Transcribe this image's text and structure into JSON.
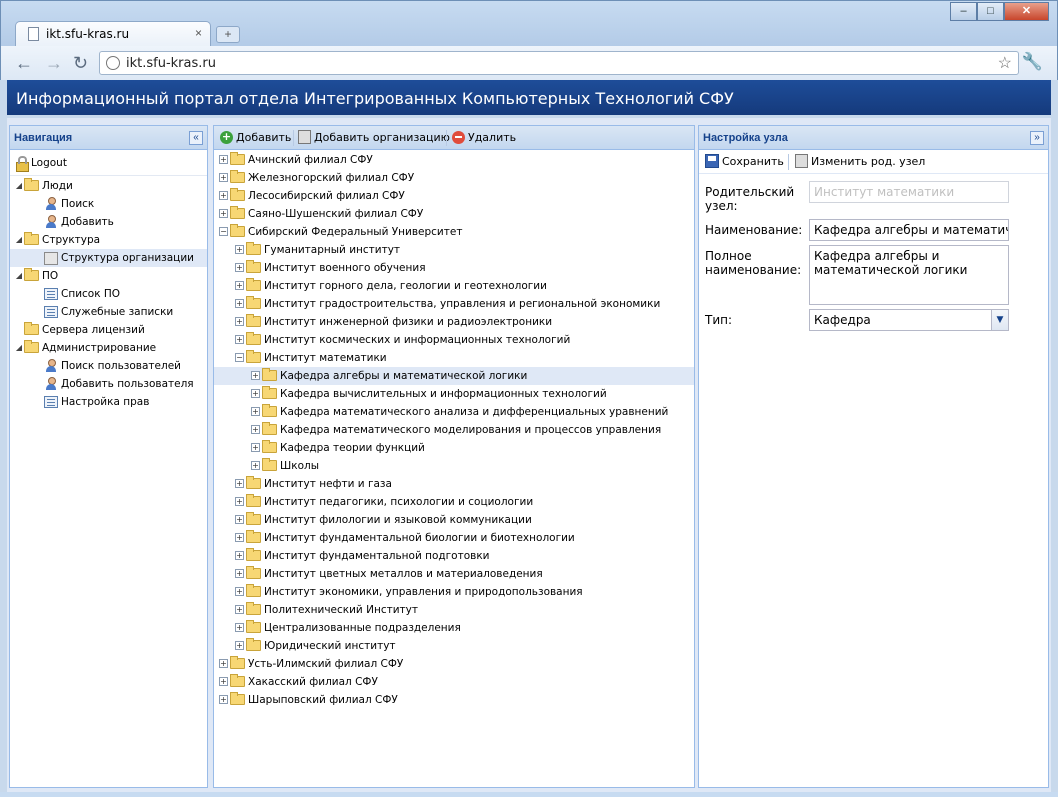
{
  "browser": {
    "tab_title": "ikt.sfu-kras.ru",
    "tab_close": "×",
    "new_tab": "+",
    "url": "ikt.sfu-kras.ru",
    "back": "←",
    "forward": "→",
    "reload": "↻",
    "star": "☆",
    "wrench": "🔧",
    "minimize": "–",
    "maximize": "□",
    "close": "✕"
  },
  "app": {
    "title": "Информационный портал отдела Интегрированных Компьютерных Технологий СФУ"
  },
  "nav": {
    "title": "Навигация",
    "collapse": "«",
    "logout": "Logout",
    "items": [
      {
        "label": "Люди",
        "level": 0,
        "icon": "folder"
      },
      {
        "label": "Поиск",
        "level": 1,
        "icon": "person"
      },
      {
        "label": "Добавить",
        "level": 1,
        "icon": "person"
      },
      {
        "label": "Структура",
        "level": 0,
        "icon": "folder"
      },
      {
        "label": "Структура организации",
        "level": 1,
        "icon": "org",
        "selected": true
      },
      {
        "label": "ПО",
        "level": 0,
        "icon": "folder"
      },
      {
        "label": "Список ПО",
        "level": 1,
        "icon": "list"
      },
      {
        "label": "Служебные записки",
        "level": 1,
        "icon": "list"
      },
      {
        "label": "Сервера лицензий",
        "level": 0,
        "icon": "folder"
      },
      {
        "label": "Администрирование",
        "level": 0,
        "icon": "folder"
      },
      {
        "label": "Поиск пользователей",
        "level": 1,
        "icon": "person"
      },
      {
        "label": "Добавить пользователя",
        "level": 1,
        "icon": "person"
      },
      {
        "label": "Настройка прав",
        "level": 1,
        "icon": "list"
      }
    ]
  },
  "tree_toolbar": {
    "add": "Добавить",
    "add_org": "Добавить организацию",
    "delete": "Удалить"
  },
  "tree": [
    {
      "label": "Ачинский филиал СФУ",
      "level": 0,
      "expanded": false
    },
    {
      "label": "Железногорский филиал СФУ",
      "level": 0,
      "expanded": false
    },
    {
      "label": "Лесосибирский филиал СФУ",
      "level": 0,
      "expanded": false
    },
    {
      "label": "Саяно-Шушенский филиал СФУ",
      "level": 0,
      "expanded": false
    },
    {
      "label": "Сибирский Федеральный Университет",
      "level": 0,
      "expanded": true
    },
    {
      "label": "Гуманитарный институт",
      "level": 1,
      "expanded": false
    },
    {
      "label": "Институт военного обучения",
      "level": 1,
      "expanded": false
    },
    {
      "label": "Институт горного дела, геологии и геотехнологии",
      "level": 1,
      "expanded": false
    },
    {
      "label": "Институт градостроительства, управления и региональной экономики",
      "level": 1,
      "expanded": false
    },
    {
      "label": "Институт инженерной физики и радиоэлектроники",
      "level": 1,
      "expanded": false
    },
    {
      "label": "Институт космических и информационных технологий",
      "level": 1,
      "expanded": false
    },
    {
      "label": "Институт математики",
      "level": 1,
      "expanded": true
    },
    {
      "label": "Кафедра алгебры и математической логики",
      "level": 2,
      "expanded": false,
      "selected": true
    },
    {
      "label": "Кафедра вычислительных и информационных технологий",
      "level": 2,
      "expanded": false
    },
    {
      "label": "Кафедра математического анализа и дифференциальных уравнений",
      "level": 2,
      "expanded": false
    },
    {
      "label": "Кафедра математического моделирования и процессов управления",
      "level": 2,
      "expanded": false
    },
    {
      "label": "Кафедра теории функций",
      "level": 2,
      "expanded": false
    },
    {
      "label": "Школы",
      "level": 2,
      "expanded": false
    },
    {
      "label": "Институт нефти и газа",
      "level": 1,
      "expanded": false
    },
    {
      "label": "Институт педагогики, психологии и социологии",
      "level": 1,
      "expanded": false
    },
    {
      "label": "Институт филологии и языковой коммуникации",
      "level": 1,
      "expanded": false
    },
    {
      "label": "Институт фундаментальной биологии и биотехнологии",
      "level": 1,
      "expanded": false
    },
    {
      "label": "Институт фундаментальной подготовки",
      "level": 1,
      "expanded": false
    },
    {
      "label": "Институт цветных металлов и материаловедения",
      "level": 1,
      "expanded": false
    },
    {
      "label": "Институт экономики, управления и природопользования",
      "level": 1,
      "expanded": false
    },
    {
      "label": "Политехнический Институт",
      "level": 1,
      "expanded": false
    },
    {
      "label": "Централизованные подразделения",
      "level": 1,
      "expanded": false
    },
    {
      "label": "Юридический институт",
      "level": 1,
      "expanded": false
    },
    {
      "label": "Усть-Илимский филиал СФУ",
      "level": 0,
      "expanded": false
    },
    {
      "label": "Хакасский филиал СФУ",
      "level": 0,
      "expanded": false
    },
    {
      "label": "Шарыповский филиал СФУ",
      "level": 0,
      "expanded": false
    }
  ],
  "form": {
    "title": "Настройка узла",
    "collapse": "»",
    "save": "Сохранить",
    "change_parent": "Изменить род. узел",
    "parent_label": "Родительский узел:",
    "parent_placeholder": "Институт математики",
    "name_label": "Наименование:",
    "name_value": "Кафедра алгебры и математической логики",
    "fullname_label": "Полное наименование:",
    "fullname_value": "Кафедра алгебры и математической логики",
    "type_label": "Тип:",
    "type_value": "Кафедра",
    "type_arrow": "▼"
  }
}
